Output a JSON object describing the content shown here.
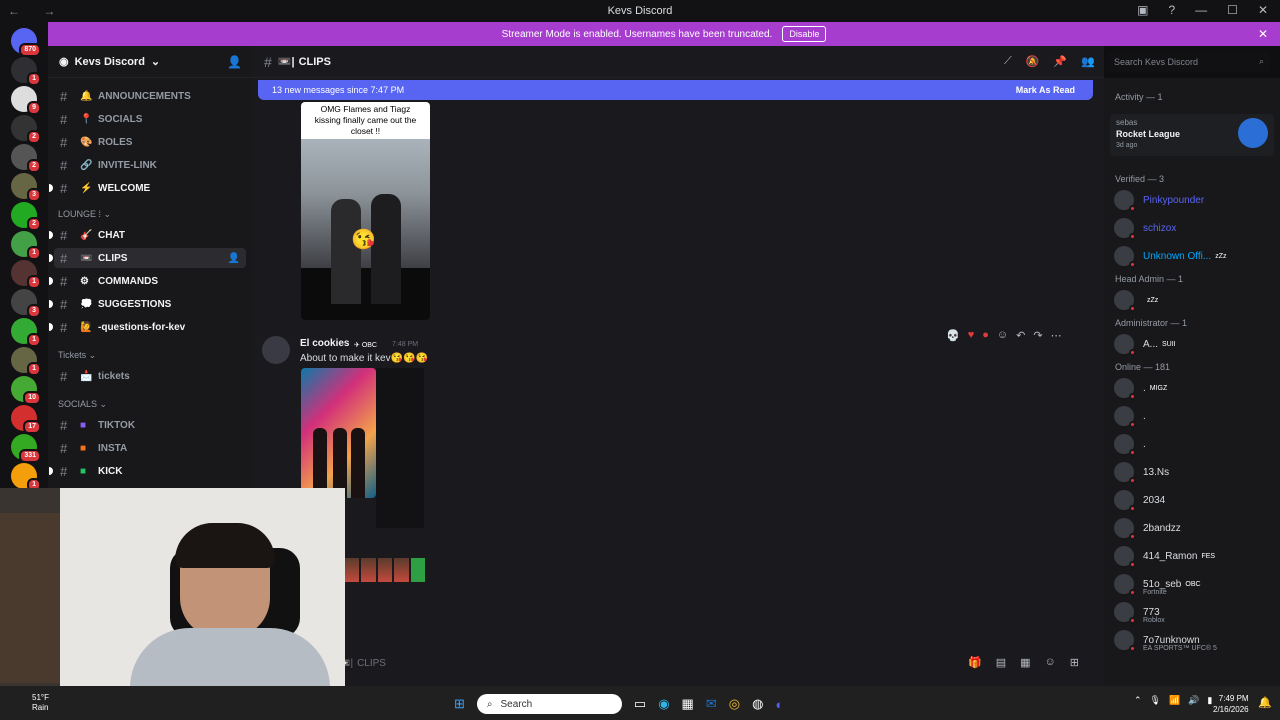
{
  "window": {
    "title": "Kevs Discord"
  },
  "banner": {
    "text": "Streamer Mode is enabled. Usernames have been truncated.",
    "disable_label": "Disable"
  },
  "server_badges": [
    "870",
    "1",
    "9",
    "2",
    "2",
    "3",
    "2",
    "1",
    "1",
    "3",
    "1",
    "1",
    "10",
    "17",
    "331",
    "1"
  ],
  "guild": {
    "name": "Kevs Discord"
  },
  "channels": [
    {
      "name": "ANNOUNCEMENTS",
      "icon": "🔔"
    },
    {
      "name": "SOCIALS",
      "icon": "📍"
    },
    {
      "name": "ROLES",
      "icon": "🎨"
    },
    {
      "name": "INVITE-LINK",
      "icon": "🔗"
    },
    {
      "name": "WELCOME",
      "icon": "⚡"
    }
  ],
  "lounge": {
    "label": "LOUNGE",
    "channels": [
      {
        "name": "CHAT",
        "icon": "🎸"
      },
      {
        "name": "CLIPS",
        "icon": "📼"
      },
      {
        "name": "COMMANDS",
        "icon": "⚙"
      },
      {
        "name": "SUGGESTIONS",
        "icon": "💭"
      },
      {
        "name": "-questions-for-kev",
        "icon": "🙋"
      }
    ]
  },
  "tickets": {
    "label": "Tickets",
    "channels": [
      {
        "name": "tickets",
        "icon": "📩"
      }
    ]
  },
  "socials_cat": {
    "label": "SOCIALS",
    "channels": [
      {
        "name": "TIKTOK",
        "color": "#8b5cf6"
      },
      {
        "name": "INSTA",
        "color": "#f97316"
      },
      {
        "name": "KICK",
        "color": "#22c55e"
      }
    ]
  },
  "header": {
    "channel": "CLIPS",
    "search_placeholder": "Search Kevs Discord"
  },
  "new_messages": {
    "text": "13 new messages since 7:47 PM",
    "mark_read": "Mark As Read"
  },
  "clip1": {
    "caption": "OMG Flames and Tiagz kissing finally came out the closet !!"
  },
  "message": {
    "author": "El cookies",
    "tag": "OBC",
    "time": "7:48 PM",
    "content": "About to make it kev😘😘😘"
  },
  "composer": {
    "placeholder": "CLIPS"
  },
  "members": {
    "activity_header": "Activity — 1",
    "activity": {
      "user": "sebas",
      "game": "Rocket League",
      "time": "3d ago"
    },
    "verified_header": "Verified — 3",
    "verified": [
      {
        "name": "Pinkypounder",
        "color": "#5865f2"
      },
      {
        "name": "schizox",
        "color": "#5865f2"
      },
      {
        "name": "Unknown Offi...",
        "color": "#00a8fc",
        "tag": "zZz"
      }
    ],
    "head_admin_header": "Head Admin — 1",
    "head_admin": [
      {
        "name": "",
        "tag": "zZz"
      }
    ],
    "admin_header": "Administrator — 1",
    "admin": [
      {
        "name": "A...",
        "tag": "SUII"
      }
    ],
    "online_header": "Online — 181",
    "online": [
      {
        "name": ".",
        "tag": "MIGZ"
      },
      {
        "name": "."
      },
      {
        "name": "."
      },
      {
        "name": "13.Ns"
      },
      {
        "name": "2034"
      },
      {
        "name": "2bandzz"
      },
      {
        "name": "414_Ramon",
        "tag": "FES"
      },
      {
        "name": "51o_seb",
        "tag": "OBC",
        "sub": "Fortnite"
      },
      {
        "name": "773",
        "sub": "Roblox"
      },
      {
        "name": "7o7unknown",
        "sub": "EA SPORTS™ UFC® 5"
      }
    ]
  },
  "taskbar": {
    "temp": "51°F",
    "weather": "Rain",
    "search": "Search",
    "time": "7:49 PM",
    "date": "2/16/2026"
  }
}
